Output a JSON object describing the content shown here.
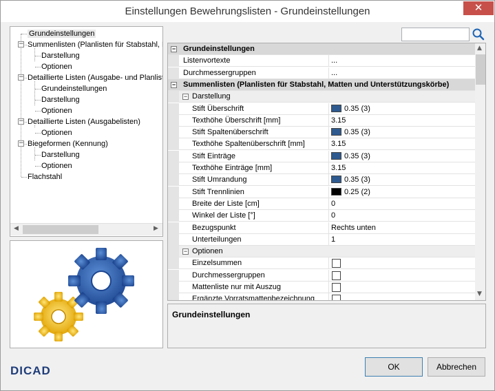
{
  "window": {
    "title": "Einstellungen Bewehrungslisten - Grundeinstellungen",
    "close_glyph": "✕"
  },
  "tree": {
    "items": [
      {
        "label": "Grundeinstellungen",
        "level": 0,
        "selected": true
      },
      {
        "label": "Summenlisten (Planlisten für Stabstahl, Ma",
        "level": 0,
        "expandable": true
      },
      {
        "label": "Darstellung",
        "level": 1
      },
      {
        "label": "Optionen",
        "level": 1
      },
      {
        "label": "Detaillierte Listen (Ausgabe- und Planliste",
        "level": 0,
        "expandable": true
      },
      {
        "label": "Grundeinstellungen",
        "level": 1
      },
      {
        "label": "Darstellung",
        "level": 1
      },
      {
        "label": "Optionen",
        "level": 1
      },
      {
        "label": "Detaillierte Listen (Ausgabelisten)",
        "level": 0,
        "expandable": true
      },
      {
        "label": "Optionen",
        "level": 1
      },
      {
        "label": "Biegeformen (Kennung)",
        "level": 0,
        "expandable": true
      },
      {
        "label": "Darstellung",
        "level": 1
      },
      {
        "label": "Optionen",
        "level": 1
      },
      {
        "label": "Flachstahl",
        "level": 0
      }
    ]
  },
  "search": {
    "placeholder": ""
  },
  "grid": {
    "rows": [
      {
        "kind": "cat",
        "label": "Grundeinstellungen"
      },
      {
        "kind": "prop",
        "label": "Listenvortexte",
        "value": "..."
      },
      {
        "kind": "prop",
        "label": "Durchmessergruppen",
        "value": "..."
      },
      {
        "kind": "cat",
        "label": "Summenlisten (Planlisten für Stabstahl, Matten und Unterstützungskörbe)"
      },
      {
        "kind": "sub",
        "label": "Darstellung"
      },
      {
        "kind": "prop",
        "label": "Stift Überschrift",
        "value": "0.35 (3)",
        "swatch": "#2e5a8f"
      },
      {
        "kind": "prop",
        "label": "Texthöhe Überschrift [mm]",
        "value": "3.15"
      },
      {
        "kind": "prop",
        "label": "Stift Spaltenüberschrift",
        "value": "0.35 (3)",
        "swatch": "#2e5a8f"
      },
      {
        "kind": "prop",
        "label": "Texthöhe Spaltenüberschrift [mm]",
        "value": "3.15"
      },
      {
        "kind": "prop",
        "label": "Stift Einträge",
        "value": "0.35 (3)",
        "swatch": "#2e5a8f"
      },
      {
        "kind": "prop",
        "label": "Texthöhe Einträge [mm]",
        "value": "3.15"
      },
      {
        "kind": "prop",
        "label": "Stift Umrandung",
        "value": "0.35 (3)",
        "swatch": "#2e5a8f"
      },
      {
        "kind": "prop",
        "label": "Stift Trennlinien",
        "value": "0.25 (2)",
        "swatch": "#000000"
      },
      {
        "kind": "prop",
        "label": "Breite der Liste [cm]",
        "value": "0"
      },
      {
        "kind": "prop",
        "label": "Winkel der Liste [°]",
        "value": "0"
      },
      {
        "kind": "prop",
        "label": "Bezugspunkt",
        "value": "Rechts unten"
      },
      {
        "kind": "prop",
        "label": "Unterteilungen",
        "value": "1"
      },
      {
        "kind": "sub",
        "label": "Optionen"
      },
      {
        "kind": "check",
        "label": "Einzelsummen",
        "checked": false
      },
      {
        "kind": "check",
        "label": "Durchmessergruppen",
        "checked": false
      },
      {
        "kind": "check",
        "label": "Mattenliste nur mit Auszug",
        "checked": false
      },
      {
        "kind": "check",
        "label": "Ergänzte Vorratsmattenbezeichnung",
        "checked": false
      }
    ]
  },
  "description": {
    "title": "Grundeinstellungen"
  },
  "footer": {
    "logo": "DICAD",
    "ok_label": "OK",
    "cancel_label": "Abbrechen"
  }
}
